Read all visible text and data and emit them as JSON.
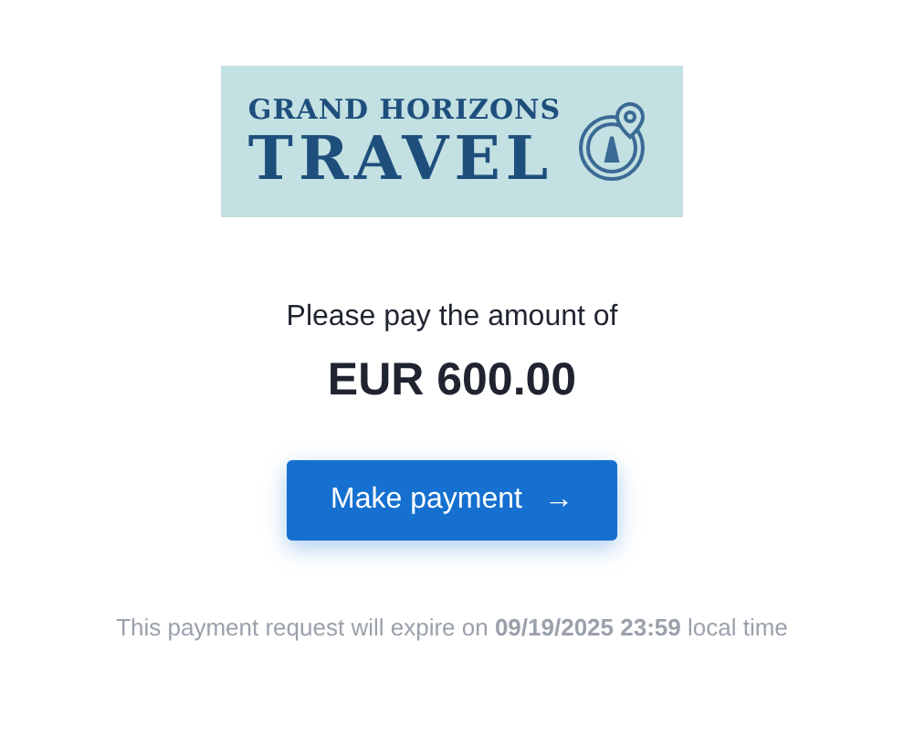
{
  "logo": {
    "line_1": "GRAND HORIZONS",
    "line_2": "TRAVEL"
  },
  "prompt": "Please pay the amount of",
  "amount": "EUR 600.00",
  "button": {
    "label": "Make payment",
    "arrow": "→"
  },
  "expiry_note": "This payment request will expire on **09/19/2025 23:59** local time"
}
